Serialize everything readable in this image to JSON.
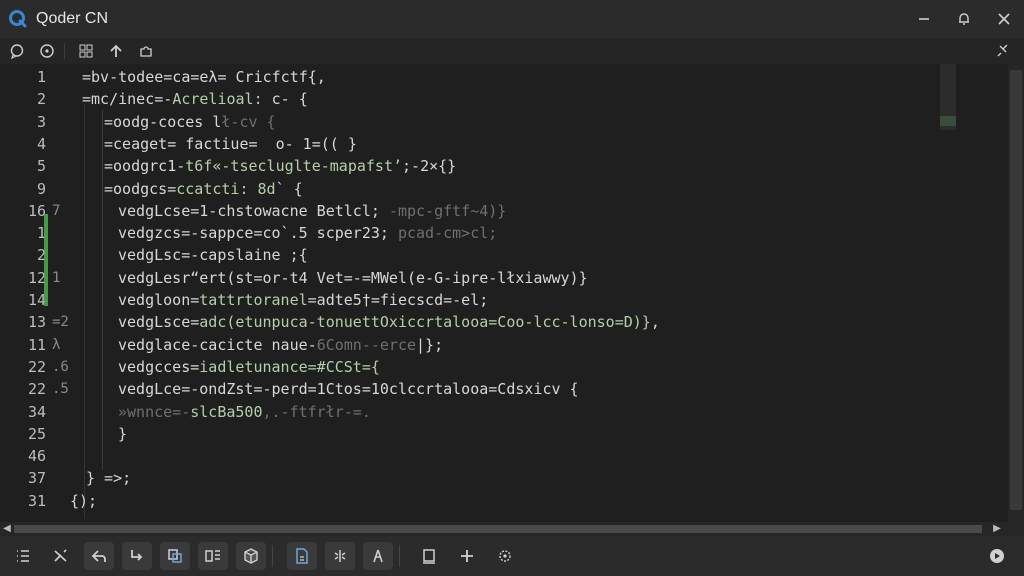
{
  "window": {
    "title": "Qoder CN",
    "accent": "#3a86d6"
  },
  "editor": {
    "gutter_primary": [
      "1",
      "2",
      "3",
      "4",
      "5",
      "9",
      "16",
      "1",
      "2",
      "12",
      "14",
      "13",
      "11",
      "22",
      "22",
      "34",
      "25",
      "46",
      "37",
      "31"
    ],
    "gutter_secondary": [
      "",
      "",
      "",
      "",
      "",
      "",
      "7",
      "",
      "",
      "1",
      "",
      "=2",
      "λ",
      ".6",
      ".5",
      "",
      "",
      "",
      "",
      ""
    ],
    "lines": [
      {
        "indent": "",
        "parts": [
          {
            "t": "=bv-todee=ca=eλ= ",
            "c": "kw"
          },
          {
            "t": "Cricfctf{,",
            "c": "kw"
          }
        ]
      },
      {
        "indent": "",
        "parts": [
          {
            "t": "=mc/inec=-",
            "c": "kw"
          },
          {
            "t": "Acrelioal:",
            "c": "grn"
          },
          {
            "t": " c- {",
            "c": "kw"
          }
        ]
      },
      {
        "indent": "  ",
        "parts": [
          {
            "t": "=oodg-coces l",
            "c": "kw"
          },
          {
            "t": "ł-cv {",
            "c": "dim"
          }
        ]
      },
      {
        "indent": "  ",
        "parts": [
          {
            "t": "=ceaget= factiue=  o- 1=(( }",
            "c": "kw"
          }
        ]
      },
      {
        "indent": "  ",
        "parts": [
          {
            "t": "=oodgrc1-",
            "c": "kw"
          },
          {
            "t": "t6f«-tsecluglte-mapafst’",
            "c": "grn"
          },
          {
            "t": ";-2×{}",
            "c": "kw"
          }
        ]
      },
      {
        "indent": "  ",
        "parts": [
          {
            "t": "=oodgcs=",
            "c": "kw"
          },
          {
            "t": "ccatcti: 8d",
            "c": "grn"
          },
          {
            "t": "` {",
            "c": "kw"
          }
        ]
      },
      {
        "indent": "   ",
        "parts": [
          {
            "t": "vedgLcse=1-chstowacne Betlcl; ",
            "c": "kw"
          },
          {
            "t": "-mpc-gftf~4)}",
            "c": "dim"
          }
        ]
      },
      {
        "indent": "   ",
        "parts": [
          {
            "t": "vedgzcs=-sappce=co`.5 scper23; ",
            "c": "kw"
          },
          {
            "t": "pcad-cm>cl;",
            "c": "dim"
          }
        ]
      },
      {
        "indent": "   ",
        "parts": [
          {
            "t": "vedgLsc=-capslaine ",
            ":c": "kw",
            "c": "kw"
          },
          {
            "t": ";{",
            "c": "kw"
          }
        ]
      },
      {
        "indent": "   ",
        "parts": [
          {
            "t": "vedgLesr“ert(st=or-t4 Vet=-=MWel(e-G-ipre-lłxiawwy)}",
            "c": "kw"
          }
        ]
      },
      {
        "indent": "   ",
        "parts": [
          {
            "t": "vedgloon=",
            "c": "kw"
          },
          {
            "t": "tattrtoranel",
            "c": "grn"
          },
          {
            "t": "=adte5†=fiecscd=-el;",
            "c": "kw"
          }
        ]
      },
      {
        "indent": "   ",
        "parts": [
          {
            "t": "vedgLsce=",
            "c": "kw"
          },
          {
            "t": "adc(etunpuca-tonuettOxiccrtalooa=Coo-lcc-lonso=D)}",
            "c": "grn"
          },
          {
            "t": ",",
            "c": "kw"
          }
        ]
      },
      {
        "indent": "   ",
        "parts": [
          {
            "t": "vedglace-cacicte naue-",
            "c": "kw"
          },
          {
            "t": "6Comn--erce",
            "c": "dim"
          },
          {
            "t": "|};",
            "c": "kw"
          }
        ]
      },
      {
        "indent": "   ",
        "parts": [
          {
            "t": "vedgcces=",
            "c": "kw"
          },
          {
            "t": "iadletunance=#CCSt={",
            "c": "grn"
          }
        ]
      },
      {
        "indent": "   ",
        "parts": [
          {
            "t": "vedgLce=-ondZst=-perd=1Ctos=10clccrtalooa=Cdsxicv {",
            "c": "kw"
          }
        ]
      },
      {
        "indent": "   ",
        "parts": [
          {
            "t": "»wnnce=-",
            "c": "dim"
          },
          {
            "t": "slcBa500",
            "c": "grn"
          },
          {
            "t": ",.-ftfrłr-=.",
            "c": "dim"
          }
        ]
      },
      {
        "indent": "   ",
        "parts": [
          {
            "t": "}",
            "c": "kw"
          }
        ]
      },
      {
        "indent": "",
        "parts": [
          {
            "t": "",
            "c": "kw"
          }
        ]
      },
      {
        "indent": " ",
        "parts": [
          {
            "t": "} =>;",
            "c": "kw"
          }
        ]
      },
      {
        "indent": "",
        "parts": [
          {
            "t": "{);",
            "c": "kw"
          }
        ]
      }
    ]
  },
  "icons": {
    "title": [
      "bell-icon",
      "close-icon",
      "minimize-icon"
    ],
    "toolbar": [
      "comment-icon",
      "record-icon",
      "grid-icon",
      "upload-icon",
      "extension-icon",
      "pin-icon"
    ],
    "bottom": [
      "list-icon",
      "scissors-icon",
      "back-icon",
      "redo-icon",
      "copy-icon",
      "compare-icon",
      "cube-icon",
      "document-icon",
      "bug-icon",
      "person-icon",
      "square-icon",
      "plus-icon",
      "settings-icon",
      "circle-play-icon"
    ]
  }
}
